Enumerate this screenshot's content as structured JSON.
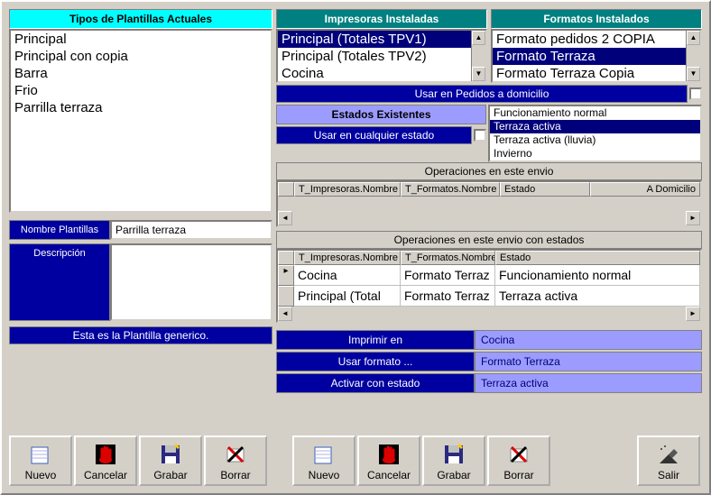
{
  "headers": {
    "plantillas": "Tipos de Plantillas Actuales",
    "impresoras": "Impresoras Instaladas",
    "formatos": "Formatos Instalados"
  },
  "plantillas": {
    "items": [
      "Principal",
      "Principal con copia",
      "Barra",
      "Frio",
      "Parrilla terraza"
    ]
  },
  "impresoras": {
    "items": [
      "Principal (Totales TPV1)",
      "Principal (Totales TPV2)",
      "Cocina"
    ],
    "selected": 0
  },
  "formatos": {
    "items": [
      "Formato pedidos 2 COPIA",
      "Formato Terraza",
      "Formato Terraza Copia"
    ],
    "selected": 1
  },
  "labels": {
    "nombre_plantillas": "Nombre Plantillas",
    "descripcion": "Descripción",
    "plantilla_generico": "Esta es la Plantilla generico.",
    "usar_pedidos": "Usar en Pedidos a domicilio",
    "estados_existentes": "Estados Existentes",
    "usar_cualquier_estado": "Usar en cualquier estado",
    "operaciones_envio": "Operaciones en este envio",
    "operaciones_envio_estados": "Operaciones en este envio con estados",
    "imprimir_en": "Imprimir en",
    "usar_formato": "Usar formato ...",
    "activar_estado": "Activar con estado"
  },
  "fields": {
    "nombre_plantillas_value": "Parrilla terraza",
    "descripcion_value": ""
  },
  "estados": {
    "items": [
      "Funcionamiento normal",
      "Terraza activa",
      "Terraza activa (lluvia)",
      "Invierno"
    ],
    "selected": 1
  },
  "grid1": {
    "columns": [
      "T_Impresoras.Nombre",
      "T_Formatos.Nombre",
      "Estado",
      "A Domicilio"
    ],
    "rows": []
  },
  "grid2": {
    "columns": [
      "T_Impresoras.Nombre",
      "T_Formatos.Nombre",
      "Estado"
    ],
    "rows": [
      {
        "impresora": "Cocina",
        "formato": "Formato Terraz",
        "estado": "Funcionamiento normal"
      },
      {
        "impresora": "Principal (Total",
        "formato": "Formato Terraz",
        "estado": "Terraza activa"
      }
    ]
  },
  "summary": {
    "imprimir_en": "Cocina",
    "usar_formato": "Formato Terraza",
    "activar_estado": "Terraza activa"
  },
  "toolbar": {
    "nuevo": "Nuevo",
    "cancelar": "Cancelar",
    "grabar": "Grabar",
    "borrar": "Borrar",
    "salir": "Salir"
  }
}
